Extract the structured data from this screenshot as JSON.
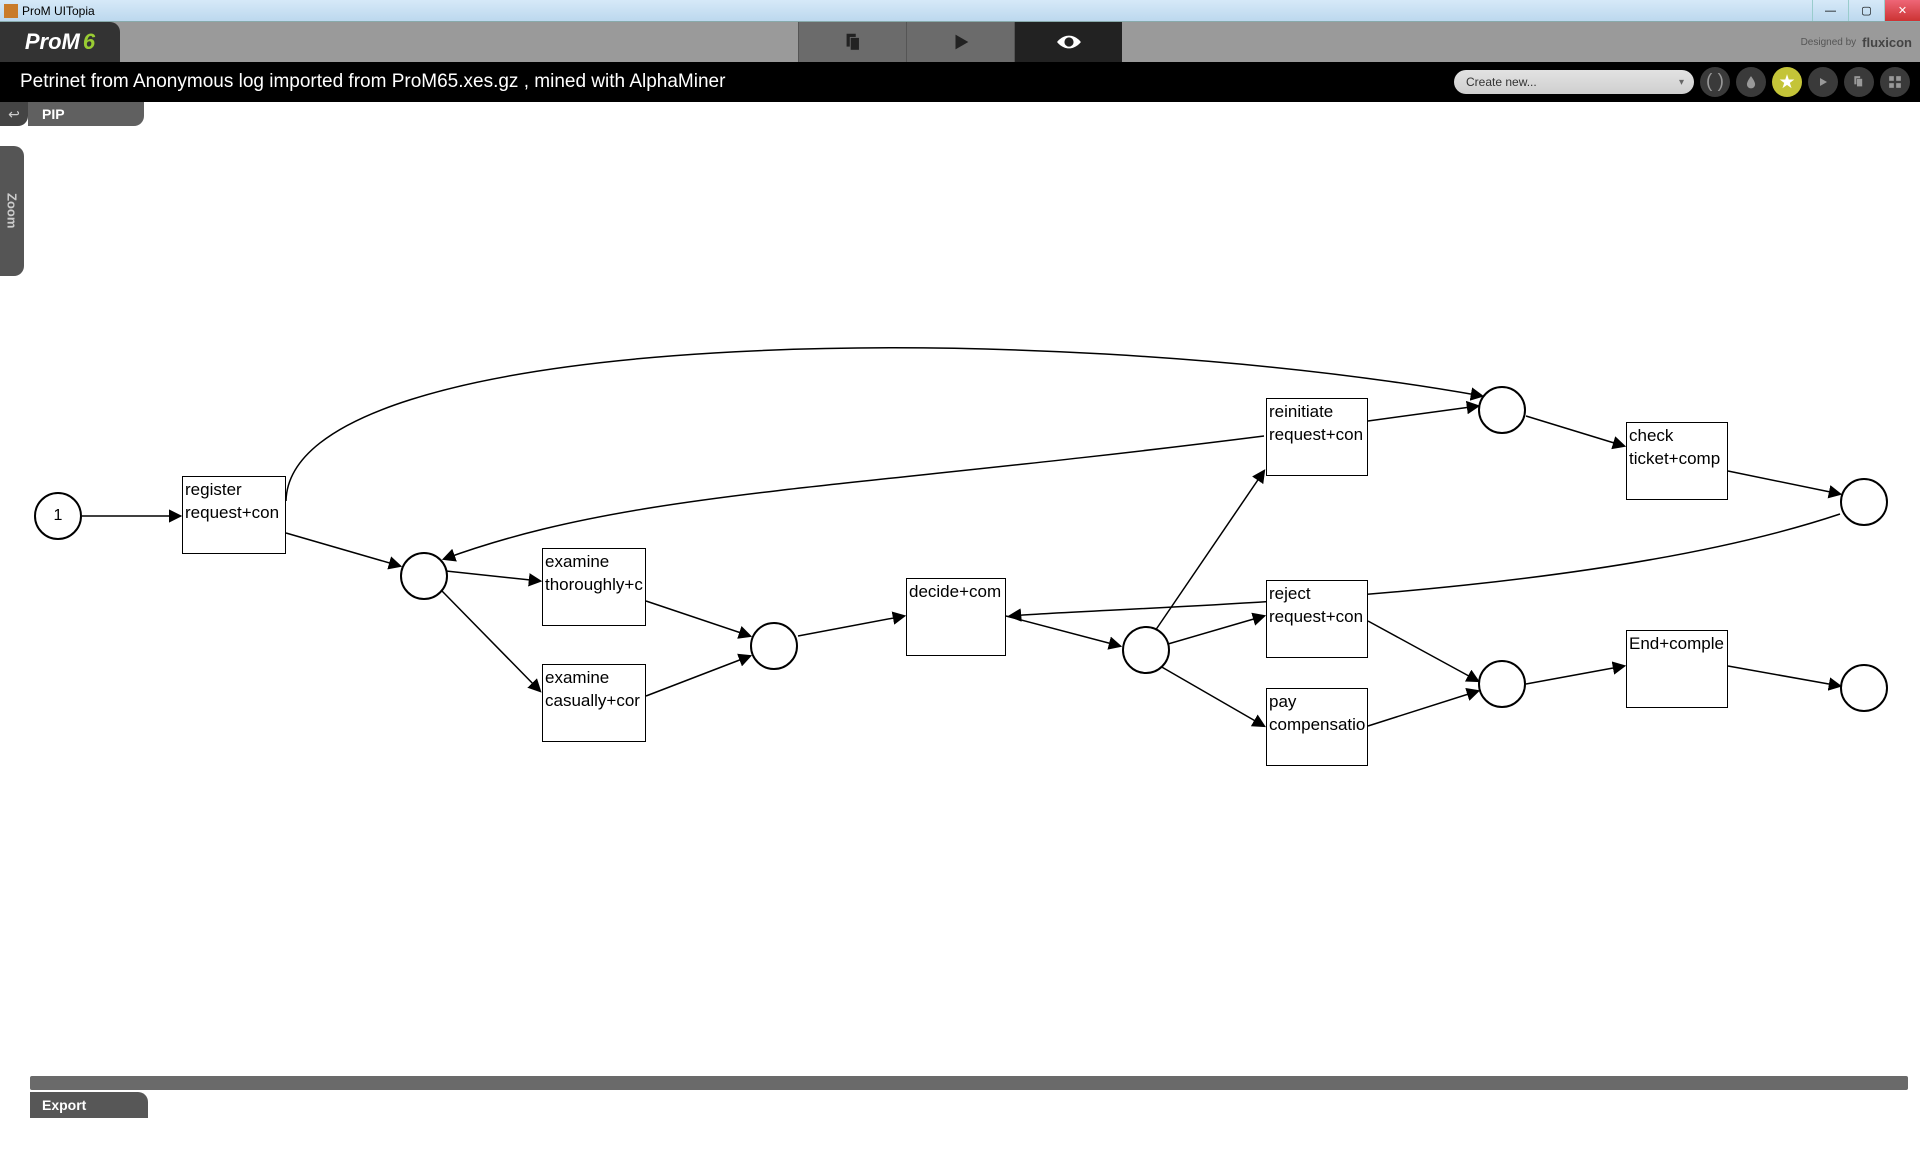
{
  "window": {
    "title": "ProM UITopia"
  },
  "logo": {
    "text": "ProM",
    "version": "6"
  },
  "designed_by": {
    "prefix": "Designed by",
    "brand": "fluxicon"
  },
  "subheader": {
    "title": "Petrinet from Anonymous log imported from ProM65.xes.gz , mined with AlphaMiner",
    "create_label": "Create new..."
  },
  "tabs": {
    "back": "↩",
    "pip": "PIP"
  },
  "sidebar": {
    "zoom": "Zoom"
  },
  "footer": {
    "export": "Export"
  },
  "petrinet": {
    "places": {
      "p0": "1",
      "p1": "",
      "p2": "",
      "p3": "",
      "p4": "",
      "p5": "",
      "p6": "",
      "p7": "",
      "p8": ""
    },
    "transitions": {
      "t_register": "register request+con",
      "t_exam_thor": "examine thoroughly+c",
      "t_exam_cas": "examine casually+cor",
      "t_decide": "decide+com",
      "t_reinit": "reinitiate request+con",
      "t_reject": "reject request+con",
      "t_paycomp": "pay compensatio",
      "t_check": "check ticket+comp",
      "t_end": "End+comple"
    }
  }
}
